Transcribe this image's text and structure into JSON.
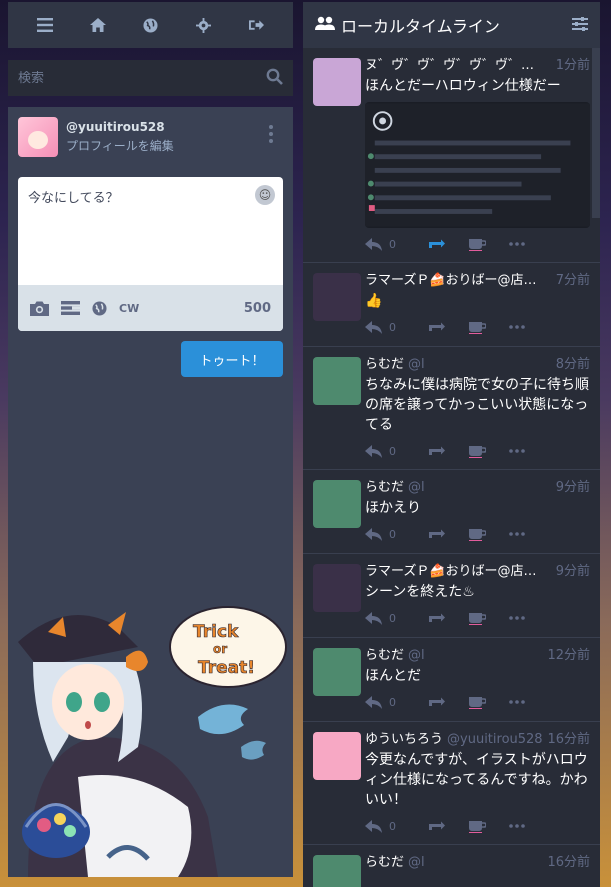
{
  "nav": {
    "items": [
      {
        "icon": "menu-icon"
      },
      {
        "icon": "home-icon"
      },
      {
        "icon": "globe-icon"
      },
      {
        "icon": "gear-icon"
      },
      {
        "icon": "logout-icon"
      }
    ]
  },
  "search": {
    "placeholder": "検索"
  },
  "account": {
    "handle": "@yuuitirou528",
    "edit_label": "プロフィールを編集"
  },
  "compose": {
    "placeholder": "今なにしてる？",
    "cw_label": "CW",
    "char_count": "500",
    "toot_label": "トゥート！"
  },
  "mascot": {
    "sign_text": [
      "Trick",
      "or",
      "Treat!"
    ]
  },
  "timeline": {
    "title": "ローカルタイムライン",
    "statuses": [
      {
        "name": "ヌ゛ヴ゛ヴ゛ヴ゛ヴ゛ヴ゛ヴ゛ヴ゛",
        "acct": "",
        "time": "1分前",
        "body": "ほんとだーハロウィン仕様だー",
        "reply_count": "0",
        "avatar_color": "#c9a6d6",
        "has_media": true
      },
      {
        "name": "ラマーズＰ🍰おりばー@店…",
        "acct": "",
        "time": "7分前",
        "body": "👍",
        "reply_count": "0",
        "avatar_color": "#3a3048",
        "has_media": false
      },
      {
        "name": "らむだ",
        "acct": "@l",
        "time": "8分前",
        "body": "ちなみに僕は病院で女の子に待ち順の席を譲ってかっこいい状態になってる",
        "reply_count": "0",
        "avatar_color": "#4e8a6e",
        "has_media": false
      },
      {
        "name": "らむだ",
        "acct": "@l",
        "time": "9分前",
        "body": "ほかえり",
        "reply_count": "0",
        "avatar_color": "#4e8a6e",
        "has_media": false
      },
      {
        "name": "ラマーズＰ🍰おりばー@店…",
        "acct": "",
        "time": "9分前",
        "body": "シーンを終えた♨",
        "reply_count": "0",
        "avatar_color": "#3a3048",
        "has_media": false
      },
      {
        "name": "らむだ",
        "acct": "@l",
        "time": "12分前",
        "body": "ほんとだ",
        "reply_count": "0",
        "avatar_color": "#4e8a6e",
        "has_media": false
      },
      {
        "name": "ゆういちろう",
        "acct": "@yuuitirou528",
        "time": "16分前",
        "body": "今更なんですが、イラストがハロウィン仕様になってるんですね。かわいい！",
        "reply_count": "0",
        "avatar_color": "#f7a8c4",
        "has_media": false
      },
      {
        "name": "らむだ",
        "acct": "@l",
        "time": "16分前",
        "body": "",
        "reply_count": "",
        "avatar_color": "#4e8a6e",
        "has_media": false
      }
    ]
  },
  "colors": {
    "accent": "#2b90d9",
    "panel": "#282c37",
    "header": "#303645"
  }
}
